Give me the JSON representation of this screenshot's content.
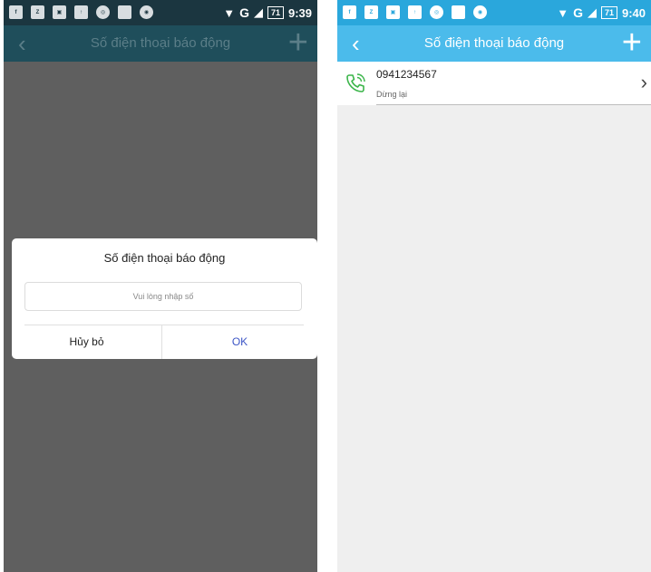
{
  "left": {
    "status": {
      "time": "9:39",
      "network": "G",
      "battery": "71"
    },
    "appbar": {
      "back": "‹",
      "title": "Số điện thoại báo động",
      "add": "+"
    },
    "dialog": {
      "title": "Số điện thoại báo động",
      "input_placeholder": "Vui lòng nhập số",
      "cancel_label": "Hủy bỏ",
      "ok_label": "OK"
    }
  },
  "right": {
    "status": {
      "time": "9:40",
      "network": "G",
      "battery": "71"
    },
    "appbar": {
      "back": "‹",
      "title": "Số điện thoại báo động",
      "add": "+"
    },
    "list": [
      {
        "number": "0941234567",
        "status": "Dừng lại",
        "icon": "phone-call-icon",
        "chevron": "›"
      }
    ]
  },
  "status_icons": [
    "facebook-icon",
    "zalo-icon",
    "gallery-icon",
    "upload-icon",
    "chrome-icon",
    "app-icon",
    "eye-icon"
  ],
  "colors": {
    "accent_right_statusbar": "#2aa7dc",
    "accent_right_appbar": "#4bbbeb",
    "ok_button": "#3d56c6",
    "phone_icon": "#3bb54a"
  }
}
